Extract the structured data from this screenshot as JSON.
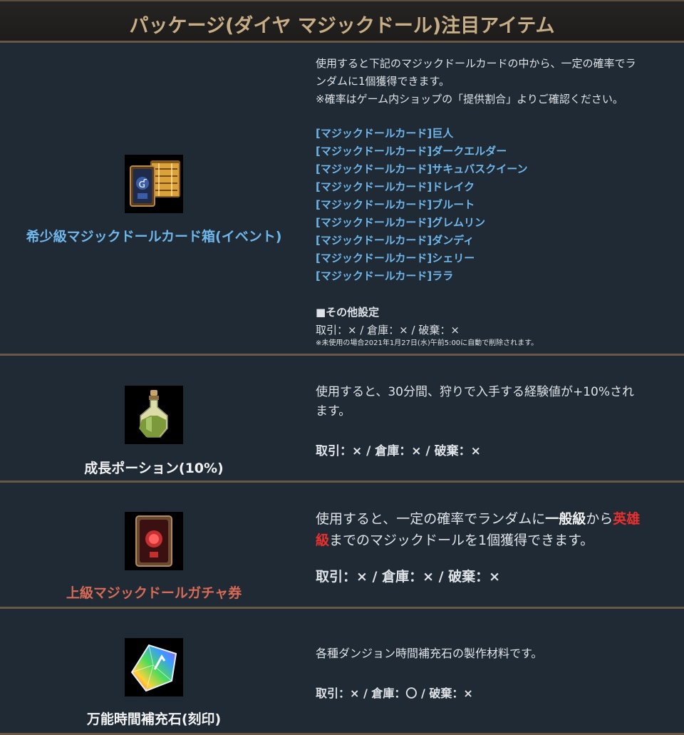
{
  "header": {
    "title": "パッケージ(ダイヤ マジックドール)注目アイテム"
  },
  "colors": {
    "header_title": "#c8ae86",
    "row_bg": "#1f2a35",
    "divider": "#6a5846",
    "link_blue": "#6fb6ea",
    "salmon": "#d96a55",
    "hero_red": "#e8312f"
  },
  "items": [
    {
      "name": "希少級マジックドールカード箱(イベント)",
      "icon": "card-chest-icon",
      "desc_line1": "使用すると下記のマジックドールカードの中から、一定の確率でラ",
      "desc_line2": "ンダムに1個獲得できます。",
      "desc_line3": "※確率はゲーム内ショップの「提供割合」よりご確認ください。",
      "cards": [
        "[マジックドールカード]巨人",
        "[マジックドールカード]ダークエルダー",
        "[マジックドールカード]サキュバスクイーン",
        "[マジックドールカード]ドレイク",
        "[マジックドールカード]ブルート",
        "[マジックドールカード]グレムリン",
        "[マジックドールカード]ダンディ",
        "[マジックドールカード]シェリー",
        "[マジックドールカード]ララ"
      ],
      "other_heading": "■その他設定",
      "trade": "取引：× / 倉庫：× / 破棄：×",
      "note": "※未使用の場合2021年1月27日(水)午前5:00に自動で削除されます。"
    },
    {
      "name": "成長ポーション(10%)",
      "icon": "potion-bottle-icon",
      "desc_line1": "使用すると、30分間、狩りで入手する経験値が+10%され",
      "desc_line2": "ます。",
      "trade": "取引：× / 倉庫：× / 破棄：×"
    },
    {
      "name": "上級マジックドールガチャ券",
      "icon": "gacha-ticket-icon",
      "desc_part1": "使用すると、一定の確率でランダムに",
      "desc_bold": "一般級",
      "desc_part2": "から",
      "desc_red1": "英雄",
      "desc_red2": "級",
      "desc_part3": "までのマジックドールを1個獲得できます。",
      "trade": "取引：× / 倉庫：× / 破棄：×"
    },
    {
      "name": "万能時間補充石(刻印)",
      "icon": "rainbow-stone-icon",
      "desc_line1": "各種ダンジョン時間補充石の製作材料です。",
      "trade": "取引：× / 倉庫：〇 / 破棄：×"
    }
  ]
}
